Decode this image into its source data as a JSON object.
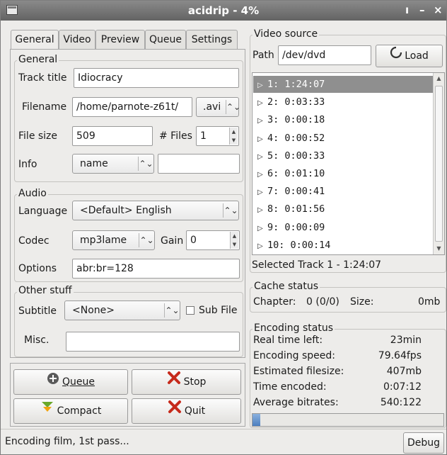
{
  "window": {
    "title": "acidrip - 4%",
    "controls": [
      "ı",
      "–",
      "×"
    ]
  },
  "tabs": [
    "General",
    "Video",
    "Preview",
    "Queue",
    "Settings"
  ],
  "general": {
    "section_label": "General",
    "track_title_label": "Track title",
    "track_title_value": "Idiocracy",
    "filename_label": "Filename",
    "filename_value": "/home/parnote-z61t/",
    "filename_ext": ".avi",
    "file_size_label": "File size",
    "file_size_value": "509",
    "files_label": "# Files",
    "files_value": "1",
    "info_label": "Info",
    "info_value": "name",
    "info_text": ""
  },
  "audio": {
    "section_label": "Audio",
    "language_label": "Language",
    "language_value": "<Default> English",
    "codec_label": "Codec",
    "codec_value": "mp3lame",
    "gain_label": "Gain",
    "gain_value": "0",
    "options_label": "Options",
    "options_value": "abr:br=128"
  },
  "other": {
    "section_label": "Other stuff",
    "subtitle_label": "Subtitle",
    "subtitle_value": "<None>",
    "subfile_label": "Sub File",
    "subfile_checked": false,
    "misc_label": "Misc.",
    "misc_value": ""
  },
  "buttons": {
    "queue": "Queue",
    "stop": "Stop",
    "compact": "Compact",
    "quit": "Quit"
  },
  "video_source": {
    "section_label": "Video source",
    "path_label": "Path",
    "path_value": "/dev/dvd",
    "load_label": "Load",
    "tracks": [
      "1: 1:24:07",
      "2: 0:03:33",
      "3: 0:00:18",
      "4: 0:00:52",
      "5: 0:00:33",
      "6: 0:01:10",
      "7: 0:00:41",
      "8: 0:01:56",
      "9: 0:00:09",
      "10: 0:00:14"
    ],
    "selected_index": 0,
    "selected_text": "Selected Track 1 - 1:24:07"
  },
  "cache_status": {
    "section_label": "Cache status",
    "chapter_label": "Chapter:",
    "chapter_value": "0 (0/0)",
    "size_label": "Size:",
    "size_value": "0mb"
  },
  "encoding_status": {
    "section_label": "Encoding status",
    "rows": [
      {
        "label": "Real time left:",
        "value": "23min"
      },
      {
        "label": "Encoding speed:",
        "value": "79.64fps"
      },
      {
        "label": "Estimated filesize:",
        "value": "407mb"
      },
      {
        "label": "Time encoded:",
        "value": "0:07:12"
      },
      {
        "label": "Average bitrates:",
        "value": "540:122"
      }
    ],
    "progress_fraction": 0.04
  },
  "statusbar": {
    "text": "Encoding film, 1st pass...",
    "debug_label": "Debug"
  },
  "colors": {
    "titlebar": "#6f6f6f",
    "selection": "#8f8f8f",
    "progress": "#5d8ccc"
  }
}
